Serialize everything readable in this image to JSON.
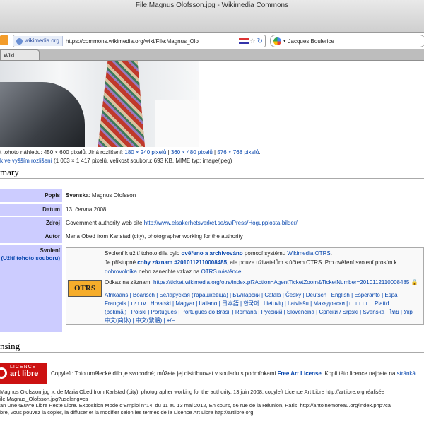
{
  "window": {
    "title": "File:Magnus Olofsson.jpg - Wikimedia Commons"
  },
  "toolbar": {
    "site_label": "wikimedia.org",
    "url": "https://commons.wikimedia.org/wiki/File:Magnus_Olo",
    "search_text": "Jacques Boulerice"
  },
  "tabs": [
    {
      "label": "Wiki"
    }
  ],
  "file_info": {
    "line1_prefix": "t tohoto náhledu:",
    "line1_main": "450 × 600 pixelů",
    "line1_mid": ". Jiná rozlišení:",
    "line1_res1": "180 × 240 pixelů",
    "line1_res2": "360 × 480 pixelů",
    "line1_res3": "576 × 768 pixelů",
    "line2_link": "k ve vyšším rozlišení",
    "line2_rest": "(1 063 × 1 417 pixelů, velikost souboru: 693 KB, MIME typ: image/jpeg)"
  },
  "summary": {
    "heading": "mary",
    "rows": [
      {
        "label": "Popis",
        "value_bold": "Svenska",
        "value": ": Magnus Olofsson"
      },
      {
        "label": "Datum",
        "value": "13. června 2008"
      },
      {
        "label": "Zdroj",
        "value": "Government authority web site",
        "link": "http://www.elsakerhetsverket.se/sv/Press/Hogupplosta-bilder/"
      },
      {
        "label": "Autor",
        "value": "Maria Obed from Karlstad (city), photographer working for the authority"
      }
    ],
    "permission_label": "Svolení",
    "permission_sub": "(Užití tohoto souboru)"
  },
  "otrs": {
    "logo": "OTRS",
    "l1a": "Svolení k užití tohoto díla bylo",
    "l1b": "ověřeno a archivováno",
    "l1c": "pomocí systému",
    "l1d": "Wikimedia OTRS",
    "l2a": "Je přístupné",
    "l2b": "coby záznam #2010112110008485",
    "l2c": ", ale pouze uživatelům s účtem OTRS. Pro ověření svolení prosím k",
    "l3a": "dobrovolníka",
    "l3b": "nebo zanechte vzkaz na",
    "l3c": "OTRS nástěnce",
    "l4a": "Odkaz na záznam:",
    "l4b": "https://ticket.wikimedia.org/otrs/index.pl?Action=AgentTicketZoom&TicketNumber=2010112110008485",
    "langs1": "Afrikaans | Boarisch | Беларуская (тарашкевіца) | Български | Català | Česky | Deutsch | English | Esperanto | Espa",
    "langs2": "Français | עברית | Hrvatski | Magyar | Italiano | 日本語 | 한국어 | Lietuvių | Latviešu | Македонски | □□□□□□ | Plattd",
    "langs3": "(bokmål) | Polski | Português | Português do Brasil | Română | Русский | Slovenčina | Српски / Srpski | Svenska | ไทย | Укр",
    "langs4": "中文(简体) | 中文(繁體) | +/−"
  },
  "licensing": {
    "heading": "nsing",
    "logo_top": "LICENCE",
    "logo_bottom": "art libre",
    "text_a": "Copyleft: Toto umělecké dílo je svobodné; můžete jej distribuovat v souladu s podmínkami",
    "text_link": "Free Art License",
    "text_b": ". Kopii této licence najdete na",
    "text_c": "stránká"
  },
  "caption": {
    "l1": "Magnus Olofsson.jpg », de Maria Obed from Karlstad (city), photographer working for the authority, 13 juin 2008, copyleft Licence Art Libre http://artlibre.org réalisée",
    "l2": "ile:Magnus_Olofsson.jpg?uselang=cs",
    "l3": "an Une Œuvre Libre Reste Libre. Exposition Mode d'Emploi n°14, du 11 au 13 mai 2012, En cours, 56 rue de la Réunion, Paris. http://antoinemoreau.org/index.php?ca",
    "l4": "bre, vous pouvez la copier, la diffuser et la modifier selon les termes de la Licence Art Libre http://artlibre.org"
  }
}
